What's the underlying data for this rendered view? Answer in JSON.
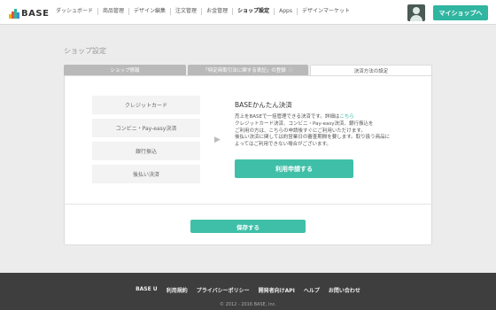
{
  "header": {
    "logo_text": "BASE",
    "nav": [
      {
        "label": "ダッシュボード"
      },
      {
        "label": "商品管理"
      },
      {
        "label": "デザイン編集"
      },
      {
        "label": "注文管理"
      },
      {
        "label": "お金管理"
      },
      {
        "label": "ショップ設定",
        "active": true
      },
      {
        "label": "Apps"
      },
      {
        "label": "デザインマーケット"
      }
    ],
    "myshop_label": "マイショップへ",
    "accent_color": "#2fb5a0"
  },
  "page": {
    "title": "ショップ設定",
    "tabs": [
      {
        "label": "ショップ情報"
      },
      {
        "label": "「特定商取引法に関する表記」の登録",
        "icon": "help-icon"
      },
      {
        "label": "決済方法の設定",
        "active": true
      }
    ]
  },
  "payment": {
    "methods": [
      "クレジットカード",
      "コンビニ・Pay-easy決済",
      "銀行振込",
      "後払い決済"
    ],
    "service_title": "BASEかんたん決済",
    "description": {
      "part1": "売上をBASEで一括管理できる決済です。詳細は",
      "link": "こちら",
      "part2": "クレジットカード決済、コンビニ・Pay-easy決済、銀行振込を",
      "part3": "ご利用の方は、こちらの申請後すぐにご利用いただけます。",
      "part4": "後払い決済に関しては約営業日の審査期間を要します。取り扱う商品に",
      "part5": "よってはご利用できない場合がございます。"
    },
    "apply_label": "利用申請する"
  },
  "save_label": "保存する",
  "footer": {
    "links": [
      "BASE U",
      "利用規約",
      "プライバシーポリシー",
      "開発者向けAPI",
      "ヘルプ",
      "お問い合わせ"
    ],
    "copyright": "© 2012 - 2016 BASE, Inc."
  }
}
